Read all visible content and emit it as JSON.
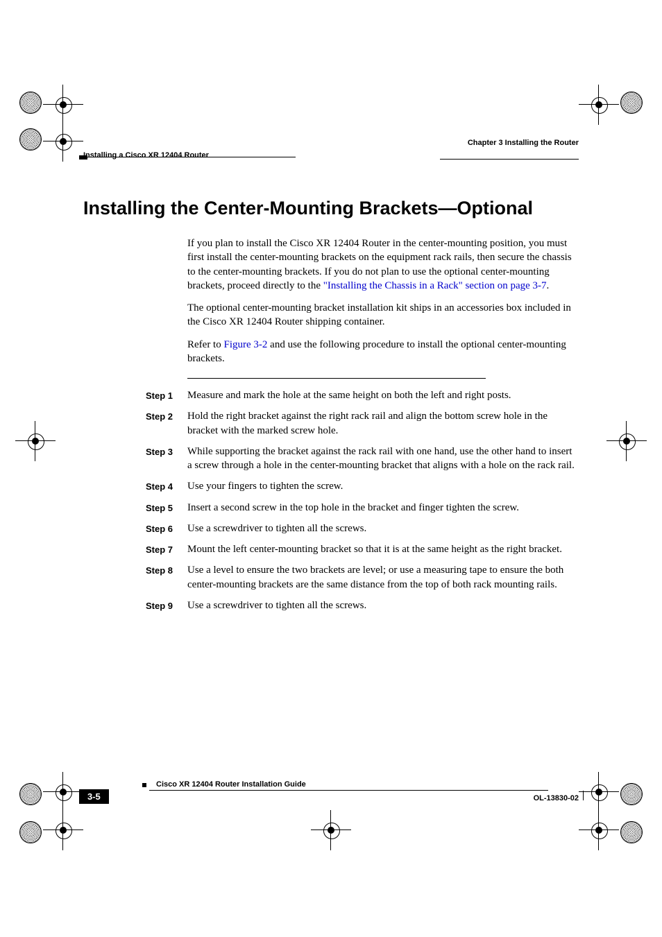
{
  "header": {
    "chapter": "Chapter 3    Installing the Router",
    "section": "Installing a Cisco XR 12404 Router"
  },
  "title": "Installing the Center-Mounting Brackets—Optional",
  "paragraphs": {
    "p1_a": "If you plan to install the Cisco XR 12404 Router in the center-mounting position, you must first install the center-mounting brackets on the equipment rack rails, then secure the chassis to the center-mounting brackets. If you do not plan to use the optional center-mounting brackets, proceed directly to the ",
    "p1_link": "\"Installing the Chassis in a Rack\" section on page 3-7",
    "p1_b": ".",
    "p2": "The optional center-mounting bracket installation kit ships in an accessories box included in the Cisco XR 12404 Router shipping container.",
    "p3_a": "Refer to ",
    "p3_link": "Figure 3-2",
    "p3_b": " and use the following procedure to install the optional center-mounting brackets."
  },
  "steps": [
    {
      "label": "Step 1",
      "text": "Measure and mark the hole at the same height on both the left and right posts."
    },
    {
      "label": "Step 2",
      "text": "Hold the right bracket against the right rack rail and align the bottom screw hole in the bracket with the marked screw hole."
    },
    {
      "label": "Step 3",
      "text": "While supporting the bracket against the rack rail with one hand, use the other hand to insert a screw through a hole in the center-mounting bracket that aligns with a hole on the rack rail."
    },
    {
      "label": "Step 4",
      "text": "Use your fingers to tighten the screw."
    },
    {
      "label": "Step 5",
      "text": "Insert a second screw in the top hole in the bracket and finger tighten the screw."
    },
    {
      "label": "Step 6",
      "text": "Use a screwdriver to tighten all the screws."
    },
    {
      "label": "Step 7",
      "text": "Mount the left center-mounting bracket so that it is at the same height as the right bracket."
    },
    {
      "label": "Step 8",
      "text": "Use a level to ensure the two brackets are level; or use a measuring tape to ensure the both center-mounting brackets are the same distance from the top of both rack mounting rails."
    },
    {
      "label": "Step 9",
      "text": "Use a screwdriver to tighten all the screws."
    }
  ],
  "footer": {
    "guide": "Cisco XR 12404 Router Installation Guide",
    "page": "3-5",
    "docid": "OL-13830-02"
  }
}
